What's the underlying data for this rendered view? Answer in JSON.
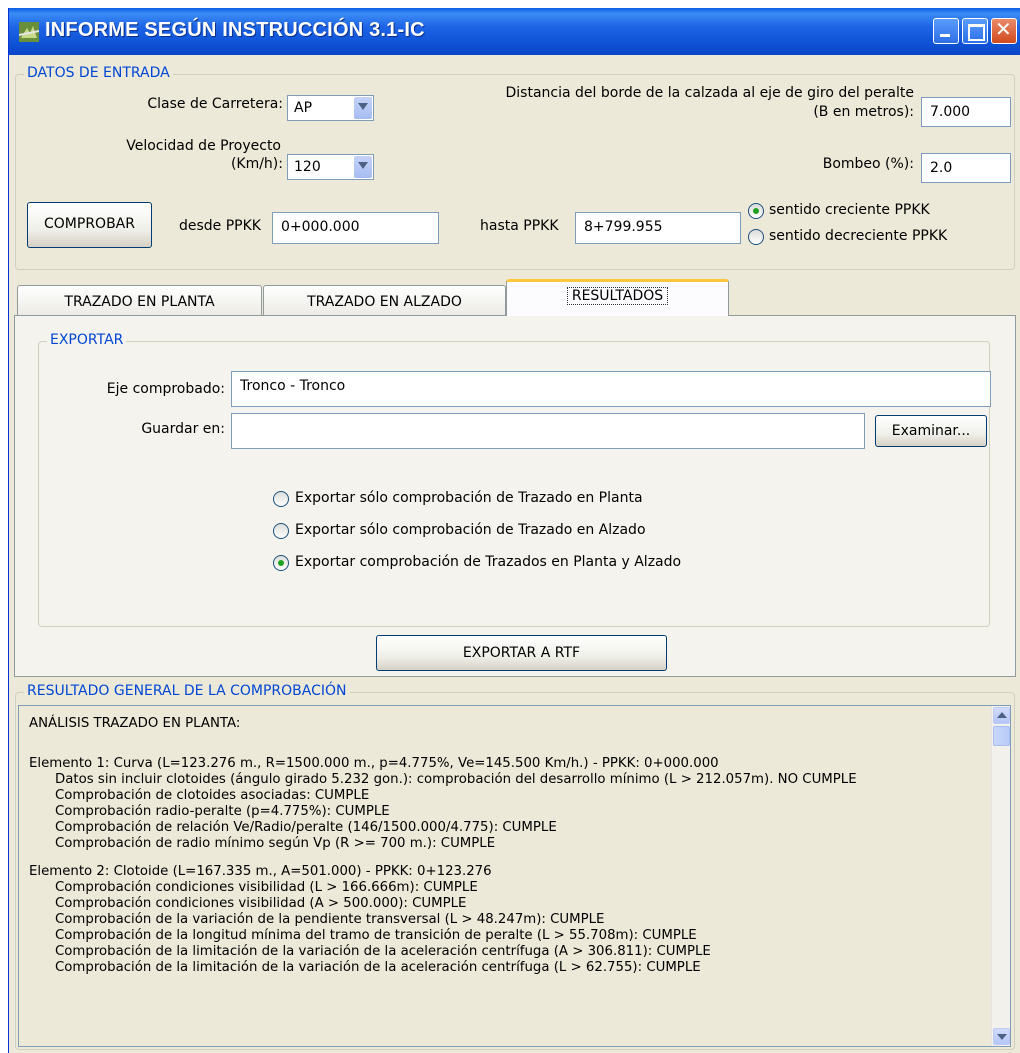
{
  "window": {
    "title": "INFORME SEGÚN INSTRUCCIÓN 3.1-IC"
  },
  "entrada": {
    "group_title": "DATOS DE ENTRADA",
    "clase_label": "Clase de Carretera:",
    "clase_value": "AP",
    "velocidad_label_1": "Velocidad de Proyecto",
    "velocidad_label_2": "(Km/h):",
    "velocidad_value": "120",
    "distancia_label_1": "Distancia del borde de la calzada al eje de giro del  peralte",
    "distancia_label_2": "(B en metros):",
    "distancia_value": "7.000",
    "bombeo_label": "Bombeo (%):",
    "bombeo_value": "2.0",
    "comprobar_label": "COMPROBAR",
    "desde_label": "desde PPKK",
    "desde_value": "0+000.000",
    "hasta_label": "hasta PPKK",
    "hasta_value": "8+799.955",
    "sentido_creciente": "sentido creciente PPKK",
    "sentido_decreciente": "sentido decreciente PPKK",
    "sentido_selected": "creciente"
  },
  "tabs": [
    {
      "label": "TRAZADO EN PLANTA"
    },
    {
      "label": "TRAZADO EN ALZADO"
    },
    {
      "label": "RESULTADOS",
      "active": true
    }
  ],
  "exportar": {
    "group_title": "EXPORTAR",
    "eje_label": "Eje comprobado:",
    "eje_value": "Tronco - Tronco",
    "guardar_label": "Guardar en:",
    "guardar_value": "",
    "examinar_label": "Examinar...",
    "options": [
      "Exportar sólo comprobación de Trazado en Planta",
      "Exportar sólo comprobación de Trazado en Alzado",
      "Exportar comprobación de Trazados en Planta y Alzado"
    ],
    "selected_option": 2,
    "exportar_rtf_label": "EXPORTAR A RTF"
  },
  "resultado": {
    "group_title": "RESULTADO GENERAL DE LA COMPROBACIÓN",
    "heading": "ANÁLISIS TRAZADO EN PLANTA:",
    "elemento1": {
      "header": "Elemento 1: Curva (L=123.276 m., R=1500.000 m., p=4.775%, Ve=145.500 Km/h.) - PPKK: 0+000.000",
      "lines": [
        "Datos sin incluir clotoides (ángulo girado 5.232 gon.):  comprobación del desarrollo mínimo (L > 212.057m). NO CUMPLE",
        "Comprobación de clotoides asociadas: CUMPLE",
        "Comprobación radio-peralte (p=4.775%): CUMPLE",
        "Comprobación de relación Ve/Radio/peralte (146/1500.000/4.775): CUMPLE",
        "Comprobación de radio mínimo según Vp (R >= 700 m.): CUMPLE"
      ]
    },
    "elemento2": {
      "header": "Elemento 2: Clotoide (L=167.335 m., A=501.000) - PPKK: 0+123.276",
      "lines": [
        "Comprobación condiciones visibilidad (L > 166.666m): CUMPLE",
        "Comprobación condiciones visibilidad (A > 500.000): CUMPLE",
        "Comprobación de la variación de la pendiente transversal (L > 48.247m): CUMPLE",
        "Comprobación de la longitud mínima del tramo de transición de peralte (L > 55.708m): CUMPLE",
        "Comprobación de la limitación de la variación de la aceleración centrífuga (A > 306.811): CUMPLE",
        "Comprobación de la limitación de la variación de la aceleración centrífuga (L > 62.755): CUMPLE"
      ]
    }
  }
}
